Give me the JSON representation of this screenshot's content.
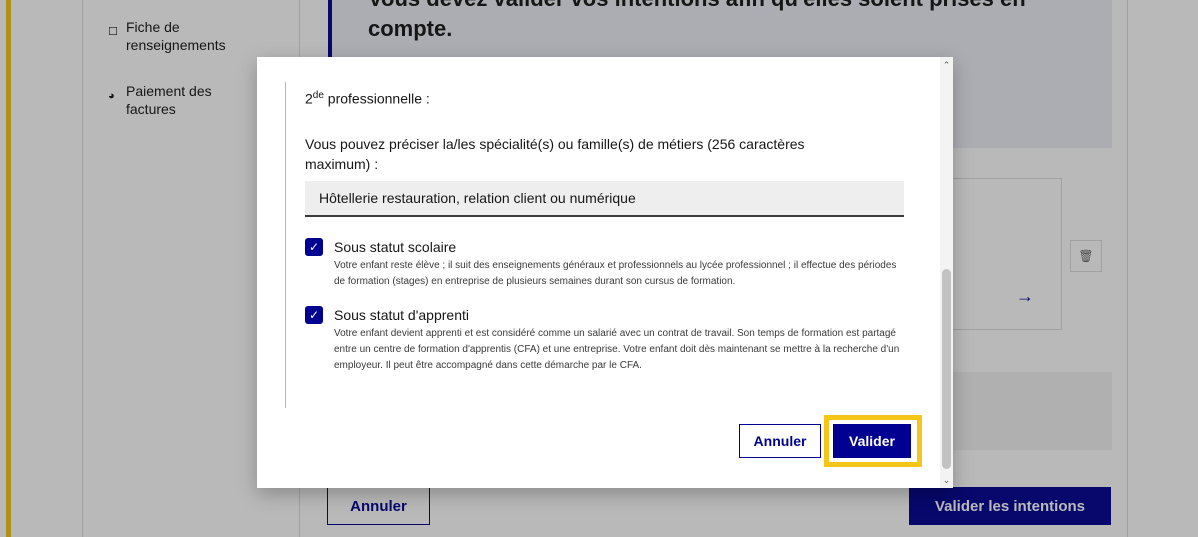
{
  "background": {
    "sidebar": [
      {
        "icon": "document-icon",
        "label": "Fiche de renseignements"
      },
      {
        "icon": "payment-icon",
        "label": "Paiement des factures"
      }
    ],
    "banner_text": "Vous devez valider vos intentions afin qu'elles soient prises en compte.",
    "cancel_label": "Annuler",
    "submit_label": "Valider les intentions"
  },
  "modal": {
    "title_prefix": "2",
    "title_sup": "de",
    "title_suffix": " professionnelle :",
    "hint": "Vous pouvez préciser la/les spécialité(s) ou famille(s) de métiers (256 caractères maximum) :",
    "input_value": "Hôtellerie restauration, relation client ou numérique",
    "options": [
      {
        "label": "Sous statut scolaire",
        "checked": true,
        "description": "Votre enfant reste élève ; il suit des enseignements généraux et professionnels au lycée professionnel ; il effectue des périodes de formation (stages) en entreprise de plusieurs semaines durant son cursus de formation."
      },
      {
        "label": "Sous statut d'apprenti",
        "checked": true,
        "description": "Votre enfant devient apprenti et est considéré comme un salarié avec un contrat de travail. Son temps de formation est partagé entre un centre de formation d'apprentis (CFA) et une entreprise. Votre enfant doit dès maintenant se mettre à la recherche d'un employeur. Il peut être accompagné dans cette démarche par le CFA."
      }
    ],
    "cancel_label": "Annuler",
    "validate_label": "Valider"
  },
  "colors": {
    "primary": "#000091",
    "highlight": "#f5c518"
  }
}
